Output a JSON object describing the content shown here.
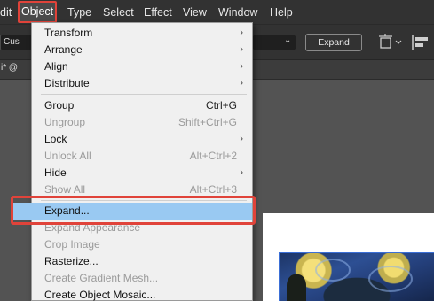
{
  "menubar": {
    "items": [
      "dit",
      "Object",
      "Type",
      "Select",
      "Effect",
      "View",
      "Window",
      "Help"
    ]
  },
  "controlbar": {
    "preset_fragment": "Cus",
    "expand_button": "Expand"
  },
  "document_tab": {
    "fragment": "i* @"
  },
  "object_menu": {
    "items": [
      {
        "label": "Transform",
        "shortcut": "",
        "submenu": true,
        "disabled": false
      },
      {
        "label": "Arrange",
        "shortcut": "",
        "submenu": true,
        "disabled": false
      },
      {
        "label": "Align",
        "shortcut": "",
        "submenu": true,
        "disabled": false
      },
      {
        "label": "Distribute",
        "shortcut": "",
        "submenu": true,
        "disabled": false
      },
      {
        "label": "Group",
        "shortcut": "Ctrl+G",
        "submenu": false,
        "disabled": false
      },
      {
        "label": "Ungroup",
        "shortcut": "Shift+Ctrl+G",
        "submenu": false,
        "disabled": true
      },
      {
        "label": "Lock",
        "shortcut": "",
        "submenu": true,
        "disabled": false
      },
      {
        "label": "Unlock All",
        "shortcut": "Alt+Ctrl+2",
        "submenu": false,
        "disabled": true
      },
      {
        "label": "Hide",
        "shortcut": "",
        "submenu": true,
        "disabled": false
      },
      {
        "label": "Show All",
        "shortcut": "Alt+Ctrl+3",
        "submenu": false,
        "disabled": true
      },
      {
        "label": "Expand...",
        "shortcut": "",
        "submenu": false,
        "disabled": false,
        "highlighted": true
      },
      {
        "label": "Expand Appearance",
        "shortcut": "",
        "submenu": false,
        "disabled": true
      },
      {
        "label": "Crop Image",
        "shortcut": "",
        "submenu": false,
        "disabled": true
      },
      {
        "label": "Rasterize...",
        "shortcut": "",
        "submenu": false,
        "disabled": false
      },
      {
        "label": "Create Gradient Mesh...",
        "shortcut": "",
        "submenu": false,
        "disabled": true
      },
      {
        "label": "Create Object Mosaic...",
        "shortcut": "",
        "submenu": false,
        "disabled": false
      }
    ]
  },
  "colors": {
    "menubar_bg": "#323232",
    "menu_bg": "#f0f0f0",
    "highlight": "#99c9f2",
    "callout_red": "#e0433a"
  }
}
